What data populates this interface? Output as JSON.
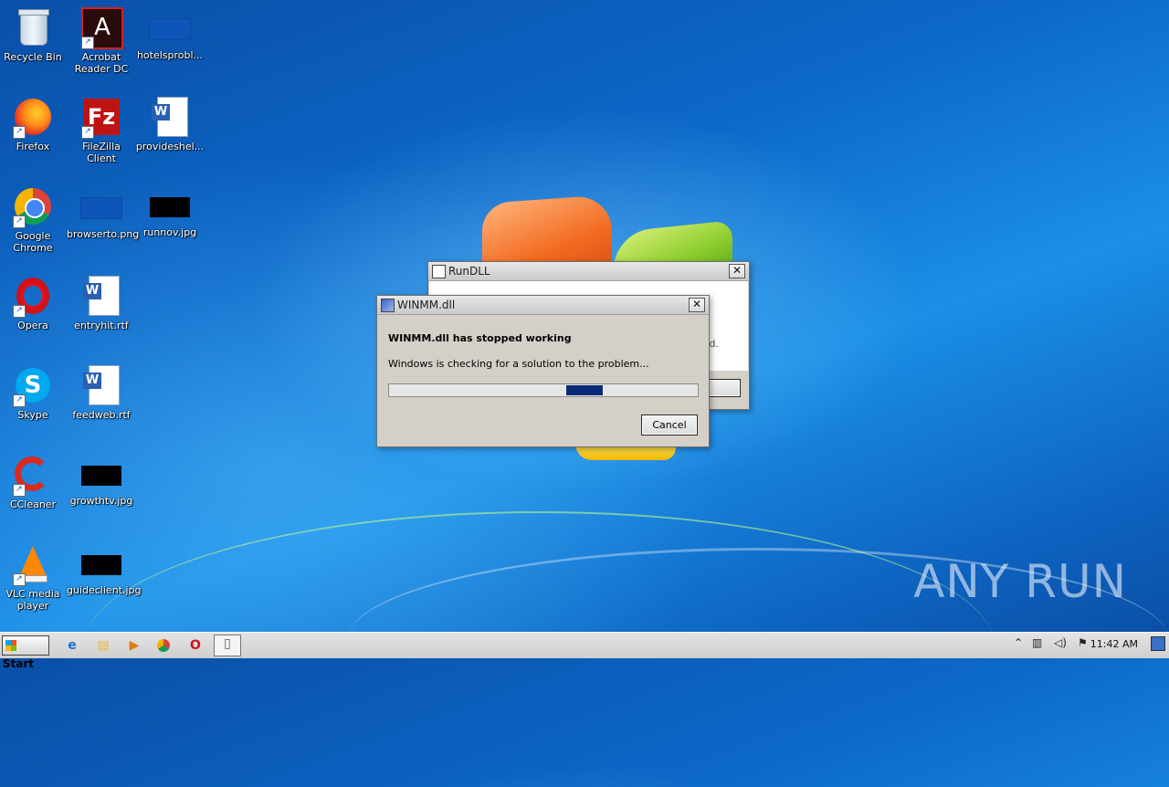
{
  "desktop": {
    "icons": [
      {
        "label": "Recycle Bin"
      },
      {
        "label": "Acrobat Reader DC"
      },
      {
        "label": "hotelsprobl..."
      },
      {
        "label": "Firefox"
      },
      {
        "label": "FileZilla Client"
      },
      {
        "label": "provideshel..."
      },
      {
        "label": "Google Chrome"
      },
      {
        "label": "browserto.png"
      },
      {
        "label": "runnov.jpg"
      },
      {
        "label": "Opera"
      },
      {
        "label": "entryhit.rtf"
      },
      {
        "label": "Skype"
      },
      {
        "label": "feedweb.rtf"
      },
      {
        "label": "CCleaner"
      },
      {
        "label": "growthtv.jpg"
      },
      {
        "label": "VLC media player"
      },
      {
        "label": "guideclient.jpg"
      }
    ]
  },
  "rundll_window": {
    "title": "RunDLL",
    "partial_text": "d."
  },
  "error_dialog": {
    "title": "WINMM.dll",
    "heading": "WINMM.dll has stopped working",
    "message": "Windows is checking for a solution to the problem...",
    "cancel_label": "Cancel",
    "progress_color": "#0b2a78"
  },
  "taskbar": {
    "start_label": "Start",
    "clock": "11:42 AM"
  },
  "watermark": "ANY RUN",
  "icons": {
    "taskbar": [
      "ie-icon",
      "explorer-icon",
      "media-player-icon",
      "chrome-icon",
      "opera-icon",
      "document-icon"
    ],
    "tray": [
      "show-hidden-icons-icon",
      "network-icon",
      "volume-icon",
      "action-center-flag-icon"
    ]
  }
}
